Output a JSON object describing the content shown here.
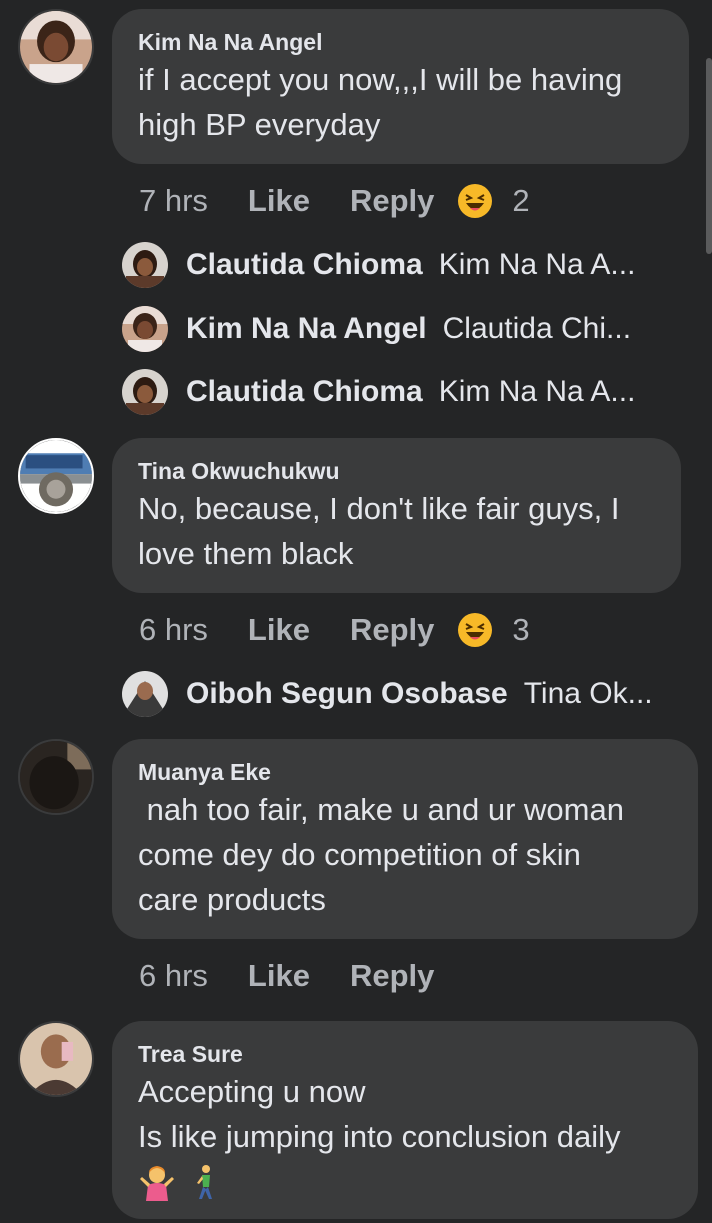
{
  "comments": [
    {
      "author": "Kim Na Na Angel",
      "text_lines": [
        "if I accept you now,,,I will be having",
        "high BP everyday"
      ],
      "time": "7 hrs",
      "like": "Like",
      "reply": "Reply",
      "reaction_icon": "laughing-emoji-icon",
      "reaction_count": "2",
      "replies": [
        {
          "name": "Clautida Chioma",
          "preview": "Kim Na Na A..."
        },
        {
          "name": "Kim Na Na Angel",
          "preview": "Clautida Chi..."
        },
        {
          "name": "Clautida Chioma",
          "preview": "Kim Na Na A..."
        }
      ]
    },
    {
      "author": "Tina Okwuchukwu",
      "text_lines": [
        "No, because, I don't like fair guys, I",
        "love them black"
      ],
      "time": "6 hrs",
      "like": "Like",
      "reply": "Reply",
      "reaction_icon": "laughing-emoji-icon",
      "reaction_count": "3",
      "replies": [
        {
          "name": "Oiboh Segun Osobase",
          "preview": "Tina Ok..."
        }
      ]
    },
    {
      "author": "Muanya Eke",
      "text_lines": [
        " nah too fair, make u and ur woman",
        "come dey do competition of skin",
        "care products"
      ],
      "time": "6 hrs",
      "like": "Like",
      "reply": "Reply"
    },
    {
      "author": "Trea Sure",
      "text_lines": [
        "Accepting u now",
        "Is like jumping into conclusion daily"
      ],
      "emojis": [
        "woman-shrugging-emoji-icon",
        "person-walking-emoji-icon"
      ]
    }
  ],
  "colors": {
    "background": "#242526",
    "bubble": "#3a3b3c",
    "primary_text": "#e4e6eb",
    "secondary_text": "#b0b3b8",
    "reaction_yellow": "#f7b928"
  }
}
